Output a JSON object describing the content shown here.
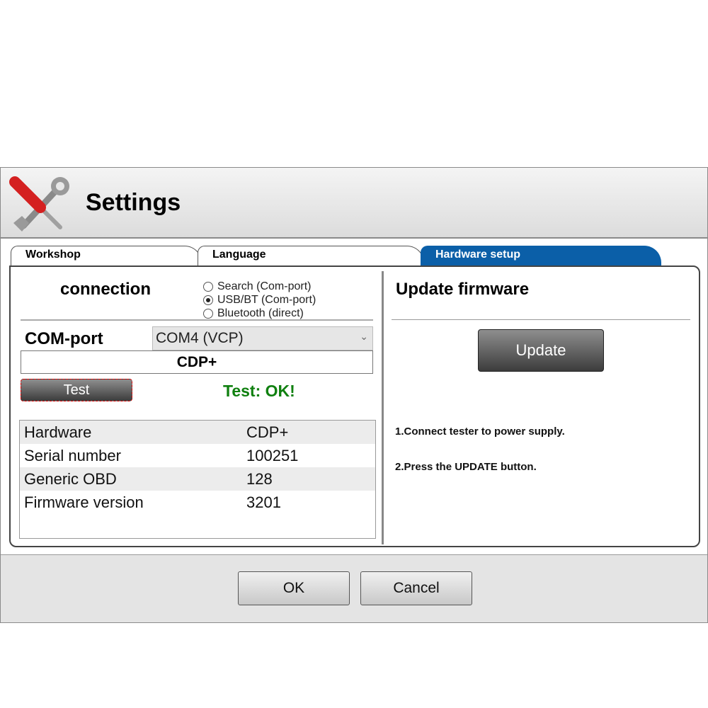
{
  "window": {
    "title": "Settings"
  },
  "tabs": [
    {
      "label": "Workshop"
    },
    {
      "label": "Language"
    },
    {
      "label": "Hardware setup",
      "active": true
    }
  ],
  "connection": {
    "heading": "connection",
    "options": [
      {
        "label": "Search (Com-port)",
        "selected": false
      },
      {
        "label": "USB/BT (Com-port)",
        "selected": true
      },
      {
        "label": "Bluetooth (direct)",
        "selected": false
      }
    ],
    "com_port_label": "COM-port",
    "com_port_value": "COM4 (VCP)",
    "device": "CDP+",
    "test_button": "Test",
    "test_status": "Test: OK!"
  },
  "info_table": [
    {
      "key": "Hardware",
      "value": "CDP+"
    },
    {
      "key": "Serial number",
      "value": "100251"
    },
    {
      "key": "Generic OBD",
      "value": "128"
    },
    {
      "key": "Firmware version",
      "value": "3201"
    }
  ],
  "firmware": {
    "heading": "Update firmware",
    "update_button": "Update",
    "steps": [
      "1.Connect tester to power supply.",
      "2.Press the UPDATE button."
    ]
  },
  "footer": {
    "ok": "OK",
    "cancel": "Cancel"
  },
  "colors": {
    "accent": "#0b5fa8",
    "ok_status": "#108010",
    "icon_red": "#d42020"
  }
}
